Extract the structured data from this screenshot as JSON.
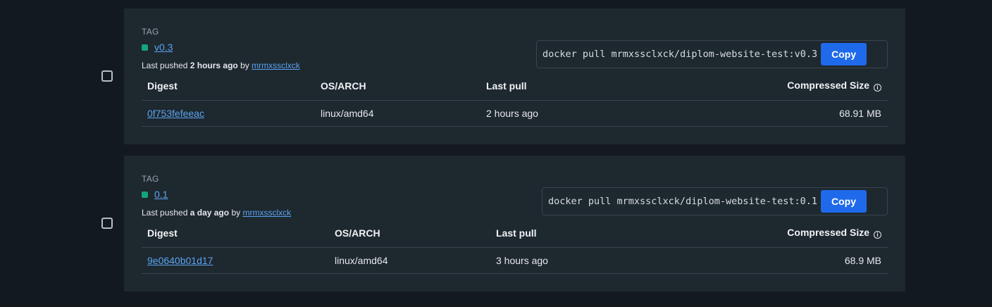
{
  "cards": [
    {
      "tag_heading": "TAG",
      "tag_name": "v0.3",
      "status_color": "#13a57e",
      "pushed_prefix": "Last pushed",
      "pushed_time": "2 hours ago",
      "pushed_by_prefix": "by",
      "pushed_by_user": "mrmxssclxck",
      "pull_command": "docker pull mrmxssclxck/diplom-website-test:v0.3",
      "copy_label": "Copy",
      "columns": {
        "digest": "Digest",
        "os_arch": "OS/ARCH",
        "last_pull": "Last pull",
        "compressed_size": "Compressed Size"
      },
      "row": {
        "digest": "0f753fefeeac",
        "os_arch": "linux/amd64",
        "last_pull": "2 hours ago",
        "compressed_size": "68.91 MB"
      }
    },
    {
      "tag_heading": "TAG",
      "tag_name": "0.1",
      "status_color": "#13a57e",
      "pushed_prefix": "Last pushed",
      "pushed_time": "a day ago",
      "pushed_by_prefix": "by",
      "pushed_by_user": "mrmxssclxck",
      "pull_command": "docker pull mrmxssclxck/diplom-website-test:0.1",
      "copy_label": "Copy",
      "columns": {
        "digest": "Digest",
        "os_arch": "OS/ARCH",
        "last_pull": "Last pull",
        "compressed_size": "Compressed Size"
      },
      "row": {
        "digest": "9e0640b01d17",
        "os_arch": "linux/amd64",
        "last_pull": "3 hours ago",
        "compressed_size": "68.9 MB"
      }
    }
  ],
  "icons": {
    "info": "info-icon",
    "status": "status-dot-icon"
  }
}
